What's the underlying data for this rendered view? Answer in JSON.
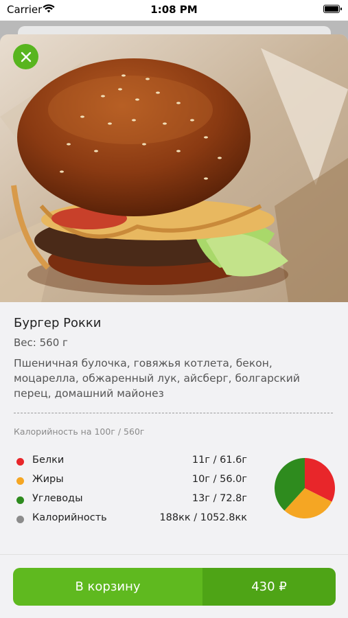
{
  "status_bar": {
    "carrier": "Carrier",
    "time": "1:08 PM"
  },
  "product": {
    "title": "Бургер Рокки",
    "weight_label": "Вес:",
    "weight_value": "560 г",
    "description": "Пшеничная булочка, говяжья котлета, бекон, моцарелла, обжаренный лук, айсберг, болгарский перец, домашний майонез",
    "calories_caption": "Калорийность на 100г / 560г"
  },
  "nutrition": [
    {
      "name": "Белки",
      "amount": "11г / 61.6г",
      "color": "#e8262a",
      "per_100g": 11
    },
    {
      "name": "Жиры",
      "amount": "10г / 56.0г",
      "color": "#f5a623",
      "per_100g": 10
    },
    {
      "name": "Углеводы",
      "amount": "13г / 72.8г",
      "color": "#2e8b1e",
      "per_100g": 13
    },
    {
      "name": "Калорийность",
      "amount": "188кк / 1052.8кк",
      "color": "#8c8c8c"
    }
  ],
  "cart": {
    "button_label": "В корзину",
    "price": "430 ₽"
  },
  "colors": {
    "accent": "#5fb91f",
    "accent_dark": "#4ea416",
    "close_button": "#58b51f"
  },
  "icons": {
    "close": "close-icon",
    "wifi": "wifi-icon",
    "battery": "battery-icon"
  }
}
